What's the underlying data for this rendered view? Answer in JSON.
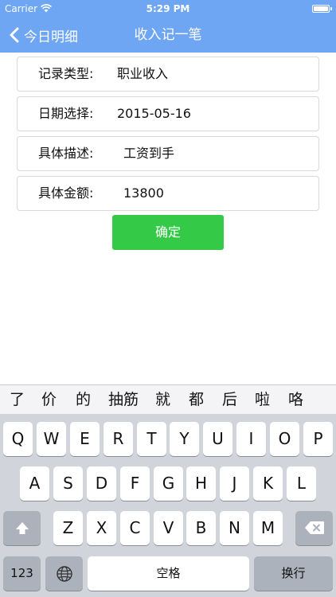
{
  "status_bar": {
    "carrier": "Carrier",
    "time": "5:29 PM"
  },
  "nav": {
    "back_label": "今日明细",
    "title": "收入记一笔"
  },
  "form": {
    "rows": [
      {
        "label": "记录类型:",
        "value": "职业收入"
      },
      {
        "label": "日期选择:",
        "value": "2015-05-16"
      },
      {
        "label": "具体描述:",
        "value": "工资到手"
      },
      {
        "label": "具体金额:",
        "value": "13800"
      }
    ],
    "confirm_label": "确定"
  },
  "candidates": [
    "了",
    "价",
    "的",
    "抽筋",
    "就",
    "都",
    "后",
    "啦",
    "咯"
  ],
  "keyboard": {
    "row1": [
      "Q",
      "W",
      "E",
      "R",
      "T",
      "Y",
      "U",
      "I",
      "O",
      "P"
    ],
    "row2": [
      "A",
      "S",
      "D",
      "F",
      "G",
      "H",
      "J",
      "K",
      "L"
    ],
    "row3": [
      "Z",
      "X",
      "C",
      "V",
      "B",
      "N",
      "M"
    ],
    "numbers_label": "123",
    "space_label": "空格",
    "return_label": "换行"
  },
  "colors": {
    "nav_bar": "#6ea6f4",
    "confirm_button": "#35c948",
    "keyboard_bg": "#d1d5db"
  }
}
